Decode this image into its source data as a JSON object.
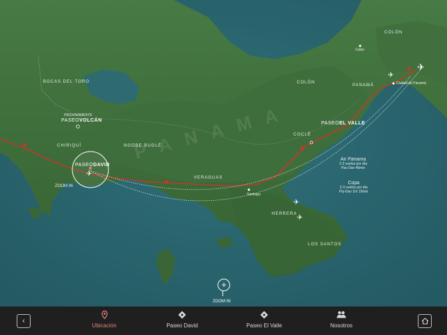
{
  "map": {
    "country_label": "PANAMA",
    "regions": [
      "COLÓN",
      "COLÓN",
      "BOCAS DEL TORO",
      "PANAMÁ",
      "COCLÉ",
      "CHIRIQUÍ",
      "NGOBE BUGLÉ",
      "VERAGUAS",
      "HERRERA",
      "LOS SANTOS"
    ],
    "towns": {
      "colon": "Colón",
      "ciudad_panama": "Ciudad de Panamá",
      "santiago": "Santiago"
    },
    "volcan": {
      "note": "PRÓXIMAMENTE",
      "prefix": "PASEO",
      "name": "VOLCÁN"
    },
    "david": {
      "prefix": "PASEO",
      "name": "DAVID",
      "zoom_label": "ZOOM IN"
    },
    "el_valle": {
      "prefix": "PASEO",
      "name": "EL VALLE"
    },
    "highway_marker": "1",
    "flights": [
      {
        "airline": "Air Panama",
        "line1": "2-3 vuelos por día",
        "line2": "Pac-Dav 45min"
      },
      {
        "airline": "Copa",
        "line1": "2-3 vuelos por día",
        "line2": "Pty-Dav 1hr 10min"
      }
    ],
    "zoom_label": "ZOOM IN"
  },
  "tabbar": {
    "back_icon": "chevron-left-icon",
    "home_icon": "home-icon",
    "tabs": [
      {
        "label": "Ubicación",
        "icon": "location-pin-icon",
        "active": true
      },
      {
        "label": "Paseo David",
        "icon": "diamond-icon",
        "active": false
      },
      {
        "label": "Paseo El Valle",
        "icon": "diamond-icon",
        "active": false
      },
      {
        "label": "Nosotros",
        "icon": "people-icon",
        "active": false
      }
    ]
  },
  "colors": {
    "sea": "#2c6770",
    "land": "#3e6b3c",
    "route": "#c0392b",
    "active_tab": "#e2847b",
    "bar": "#1f1f1f"
  }
}
